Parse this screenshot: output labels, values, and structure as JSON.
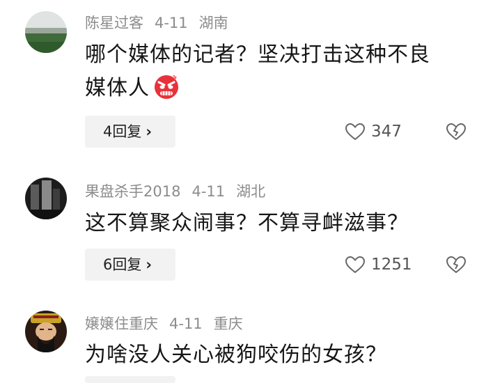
{
  "comments": [
    {
      "username": "陈星过客",
      "date": "4-11",
      "location": "湖南",
      "text_line1": "哪个媒体的记者？坚决打击这种不良",
      "text_line2": "媒体人",
      "emoji": "angry-face-icon",
      "replies": "4回复",
      "likes": "347"
    },
    {
      "username": "果盘杀手2018",
      "date": "4-11",
      "location": "湖北",
      "text_line1": "这不算聚众闹事？不算寻衅滋事？",
      "replies": "6回复",
      "likes": "1251"
    },
    {
      "username": "嬢嬢住重庆",
      "date": "4-11",
      "location": "重庆",
      "text_line1": "为啥没人关心被狗咬伤的女孩？"
    }
  ],
  "icons": {
    "reply_chevron": "›",
    "like": "heart-outline-icon",
    "dislike": "broken-heart-icon"
  },
  "colors": {
    "meta_text": "#8c8c8c",
    "body_text": "#161616",
    "reply_bg": "#f2f2f2"
  }
}
